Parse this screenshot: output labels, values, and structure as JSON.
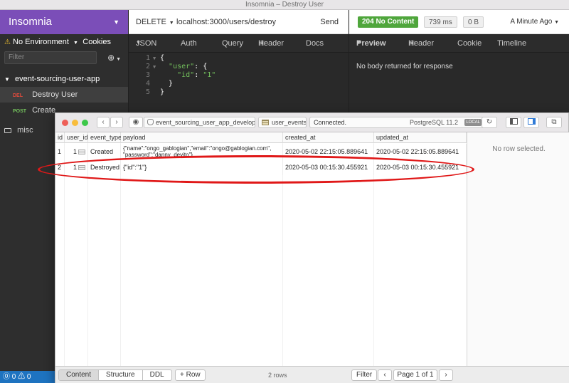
{
  "window": {
    "title": "Insomnia – Destroy User"
  },
  "sidebar": {
    "brand": "Insomnia",
    "environment": "No Environment",
    "cookies": "Cookies",
    "filter_placeholder": "Filter",
    "folder": "event-sourcing-user-app",
    "requests": [
      {
        "method": "DEL",
        "name": "Destroy User"
      },
      {
        "method": "POST",
        "name": "Create"
      }
    ],
    "misc": "misc"
  },
  "request": {
    "method": "DELETE",
    "url": "localhost:3000/users/destroy",
    "send": "Send",
    "tabs": [
      "JSON",
      "Auth",
      "Query",
      "Header",
      "Docs"
    ],
    "header_count": "1",
    "body_lines": [
      {
        "ln": "1",
        "text": "{"
      },
      {
        "ln": "2",
        "key": "\"user\"",
        "rest": ": {"
      },
      {
        "ln": "3",
        "key": "\"id\"",
        "rest": ": ",
        "val": "\"1\""
      },
      {
        "ln": "4",
        "text": "  }"
      },
      {
        "ln": "5",
        "text": "}"
      }
    ]
  },
  "response": {
    "status": "204 No Content",
    "time": "739 ms",
    "size": "0 B",
    "ago": "A Minute Ago",
    "tabs": [
      "Preview",
      "Header",
      "Cookie",
      "Timeline"
    ],
    "header_count": "9",
    "message": "No body returned for response"
  },
  "footer": {
    "status": "⓪ 0 ⚠ 0"
  },
  "db": {
    "database": "event_sourcing_user_app_developm",
    "table": "user_events",
    "connection": "Connected.",
    "version": "PostgreSQL 11.2",
    "local": "LOCAL",
    "columns": [
      "id",
      "user_id",
      "event_type",
      "payload",
      "created_at",
      "updated_at"
    ],
    "rows": [
      {
        "id": "1",
        "user_id": "1",
        "event_type": "Created",
        "payload_line1": "{\"name\":\"ongo_gablogian\",\"email\":\"ongo@gablogian.com\",",
        "payload_line2": "\"password\":\"danny_devito\"}",
        "created_at": "2020-05-02 22:15:05.889641",
        "updated_at": "2020-05-02 22:15:05.889641"
      },
      {
        "id": "2",
        "user_id": "1",
        "event_type": "Destroyed",
        "payload": "{\"id\":\"1\"}",
        "created_at": "2020-05-03 00:15:30.455921",
        "updated_at": "2020-05-03 00:15:30.455921"
      }
    ],
    "detail_empty": "No row selected.",
    "bottom_tabs": [
      "Content",
      "Structure",
      "DDL"
    ],
    "add_row": "+ Row",
    "row_count": "2 rows",
    "filter": "Filter",
    "page": "Page 1 of 1"
  }
}
